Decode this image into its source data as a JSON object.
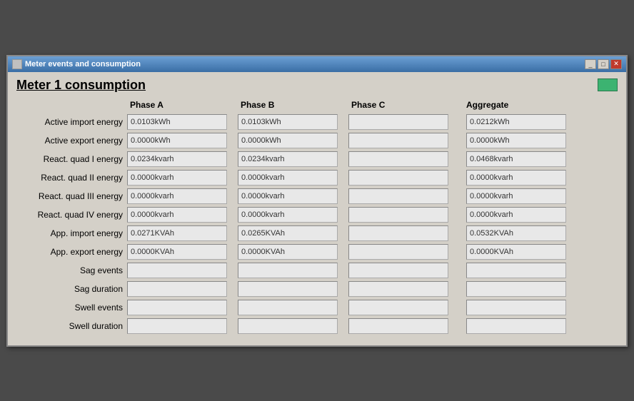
{
  "titleBar": {
    "title": "Meter events and consumption",
    "minimizeLabel": "_",
    "maximizeLabel": "□",
    "closeLabel": "✕"
  },
  "pageTitle": "Meter 1 consumption",
  "columns": {
    "phaseA": "Phase A",
    "phaseB": "Phase B",
    "phaseC": "Phase C",
    "aggregate": "Aggregate"
  },
  "rows": [
    {
      "label": "Active import energy",
      "phaseA": "0.0103kWh",
      "phaseB": "0.0103kWh",
      "phaseC": "",
      "aggregate": "0.0212kWh"
    },
    {
      "label": "Active export energy",
      "phaseA": "0.0000kWh",
      "phaseB": "0.0000kWh",
      "phaseC": "",
      "aggregate": "0.0000kWh"
    },
    {
      "label": "React. quad I energy",
      "phaseA": "0.0234kvarh",
      "phaseB": "0.0234kvarh",
      "phaseC": "",
      "aggregate": "0.0468kvarh"
    },
    {
      "label": "React. quad II energy",
      "phaseA": "0.0000kvarh",
      "phaseB": "0.0000kvarh",
      "phaseC": "",
      "aggregate": "0.0000kvarh"
    },
    {
      "label": "React. quad III energy",
      "phaseA": "0.0000kvarh",
      "phaseB": "0.0000kvarh",
      "phaseC": "",
      "aggregate": "0.0000kvarh"
    },
    {
      "label": "React. quad IV energy",
      "phaseA": "0.0000kvarh",
      "phaseB": "0.0000kvarh",
      "phaseC": "",
      "aggregate": "0.0000kvarh"
    },
    {
      "label": "App. import energy",
      "phaseA": "0.0271KVAh",
      "phaseB": "0.0265KVAh",
      "phaseC": "",
      "aggregate": "0.0532KVAh"
    },
    {
      "label": "App. export energy",
      "phaseA": "0.0000KVAh",
      "phaseB": "0.0000KVAh",
      "phaseC": "",
      "aggregate": "0.0000KVAh"
    },
    {
      "label": "Sag events",
      "phaseA": "",
      "phaseB": "",
      "phaseC": "",
      "aggregate": ""
    },
    {
      "label": "Sag duration",
      "phaseA": "",
      "phaseB": "",
      "phaseC": "",
      "aggregate": ""
    },
    {
      "label": "Swell events",
      "phaseA": "",
      "phaseB": "",
      "phaseC": "",
      "aggregate": ""
    },
    {
      "label": "Swell duration",
      "phaseA": "",
      "phaseB": "",
      "phaseC": "",
      "aggregate": ""
    }
  ]
}
